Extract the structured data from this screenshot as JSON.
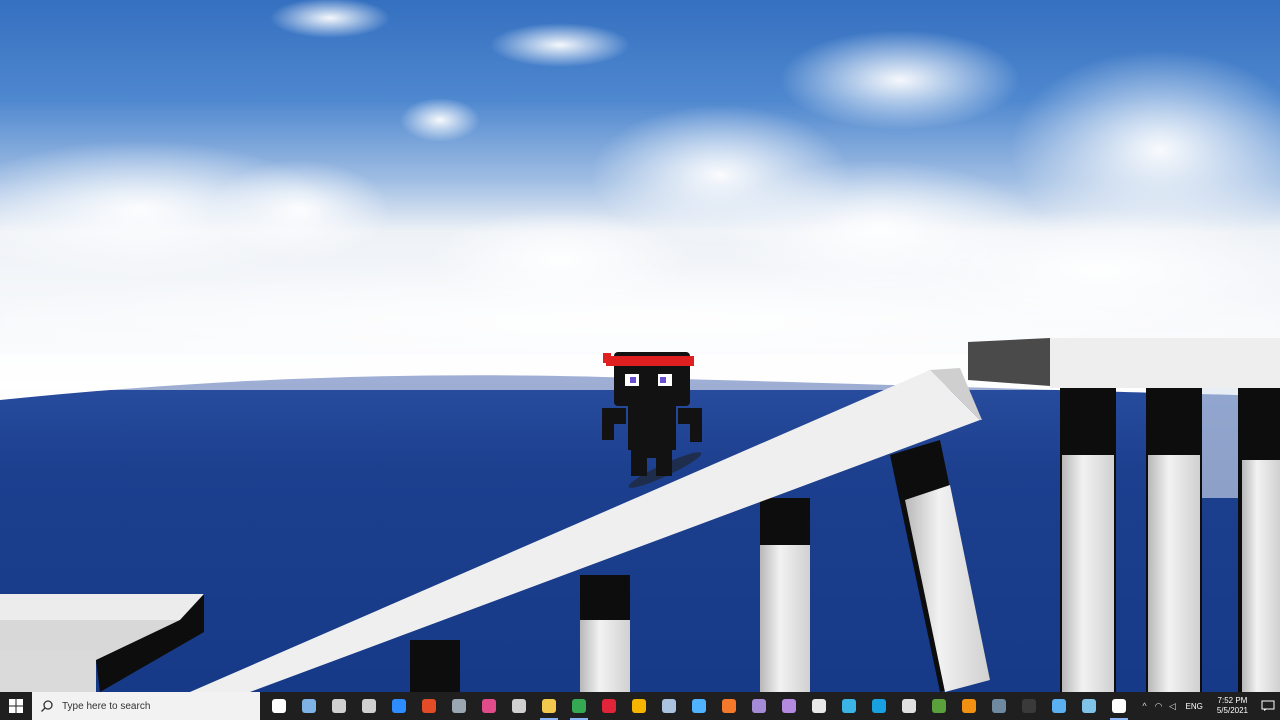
{
  "taskbar": {
    "search_placeholder": "Type here to search",
    "apps": [
      {
        "name": "task-view-icon",
        "color": "#ffffff",
        "running": false
      },
      {
        "name": "virtualbox-icon",
        "color": "#7fb3e6",
        "running": false
      },
      {
        "name": "file-manager-icon",
        "color": "#cfcfcf",
        "running": false
      },
      {
        "name": "shield-icon",
        "color": "#d0d0d0",
        "running": false
      },
      {
        "name": "zoom-icon",
        "color": "#2d8cff",
        "running": false
      },
      {
        "name": "office-icon",
        "color": "#e34c26",
        "running": false
      },
      {
        "name": "camera-icon",
        "color": "#9aa6b2",
        "running": false
      },
      {
        "name": "droplet-icon",
        "color": "#e04c8a",
        "running": false
      },
      {
        "name": "paint-icon",
        "color": "#cfcfcf",
        "running": false
      },
      {
        "name": "folder-icon",
        "color": "#f2c94c",
        "running": true
      },
      {
        "name": "chrome-icon",
        "color": "#34a853",
        "running": true
      },
      {
        "name": "opera-icon",
        "color": "#e0243a",
        "running": false
      },
      {
        "name": "chrome-canary-icon",
        "color": "#f4b400",
        "running": false
      },
      {
        "name": "steam-icon",
        "color": "#aac4e0",
        "running": false
      },
      {
        "name": "crystal-icon",
        "color": "#4fb3ff",
        "running": false
      },
      {
        "name": "blender-icon",
        "color": "#f5792a",
        "running": false
      },
      {
        "name": "rocket-icon",
        "color": "#a58bd6",
        "running": false
      },
      {
        "name": "cube-icon",
        "color": "#b48ae0",
        "running": false
      },
      {
        "name": "unreal-icon",
        "color": "#e8e8e8",
        "running": false
      },
      {
        "name": "edge-icon",
        "color": "#3bb4e5",
        "running": false
      },
      {
        "name": "tile-app-icon",
        "color": "#19a0e0",
        "running": false
      },
      {
        "name": "roblox-icon",
        "color": "#e0e0e0",
        "running": false
      },
      {
        "name": "minecraft-icon",
        "color": "#5aa03c",
        "running": false
      },
      {
        "name": "orange-app-icon",
        "color": "#f29111",
        "running": false
      },
      {
        "name": "terminal-icon",
        "color": "#6d8aa0",
        "running": false
      },
      {
        "name": "two-icon",
        "color": "#3a3a3a",
        "running": false
      },
      {
        "name": "weather-icon",
        "color": "#5ab0f0",
        "running": false
      },
      {
        "name": "window-app-icon",
        "color": "#7fc3e8",
        "running": false
      },
      {
        "name": "unreal-editor-icon",
        "color": "#ffffff",
        "running": true
      }
    ],
    "tray": {
      "language": "ENG",
      "time": "7:52 PM",
      "date": "5/5/2021"
    }
  },
  "colors": {
    "sky_top": "#3a74c4",
    "sky_mid": "#6b9ad6",
    "ocean": "#1a3e8c",
    "platform": "#e6e6e6",
    "character": "#121212",
    "headband": "#e02020"
  }
}
